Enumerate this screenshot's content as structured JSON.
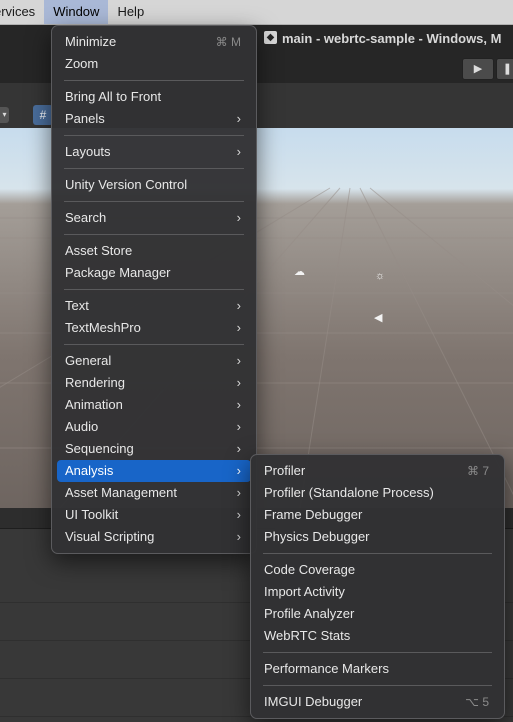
{
  "menubar": {
    "items": [
      "ervices",
      "Window",
      "Help"
    ]
  },
  "window_title": "main - webrtc-sample - Windows, M",
  "icons": {
    "unity": "unity-logo-icon",
    "play": "play-icon",
    "pause": "pause-icon",
    "grid": "grid-icon",
    "arrow": "chevron-right-icon"
  },
  "window_menu": {
    "minimize": "Minimize",
    "minimize_shortcut": "⌘ M",
    "zoom": "Zoom",
    "bring_all_to_front": "Bring All to Front",
    "panels": "Panels",
    "layouts": "Layouts",
    "unity_version_control": "Unity Version Control",
    "search": "Search",
    "asset_store": "Asset Store",
    "package_manager": "Package Manager",
    "text": "Text",
    "textmeshpro": "TextMeshPro",
    "general": "General",
    "rendering": "Rendering",
    "animation": "Animation",
    "audio": "Audio",
    "sequencing": "Sequencing",
    "analysis": "Analysis",
    "asset_management": "Asset Management",
    "ui_toolkit": "UI Toolkit",
    "visual_scripting": "Visual Scripting",
    "arrow_glyph": "›"
  },
  "analysis_menu": {
    "profiler": "Profiler",
    "profiler_shortcut": "⌘ 7",
    "profiler_standalone": "Profiler (Standalone Process)",
    "frame_debugger": "Frame Debugger",
    "physics_debugger": "Physics Debugger",
    "code_coverage": "Code Coverage",
    "import_activity": "Import Activity",
    "profile_analyzer": "Profile Analyzer",
    "webrtc_stats": "WebRTC Stats",
    "performance_markers": "Performance Markers",
    "imgui_debugger": "IMGUI Debugger",
    "imgui_shortcut": "⌥ 5"
  },
  "colors": {
    "selection": "#1865c8",
    "menu_bg": "#323234"
  }
}
